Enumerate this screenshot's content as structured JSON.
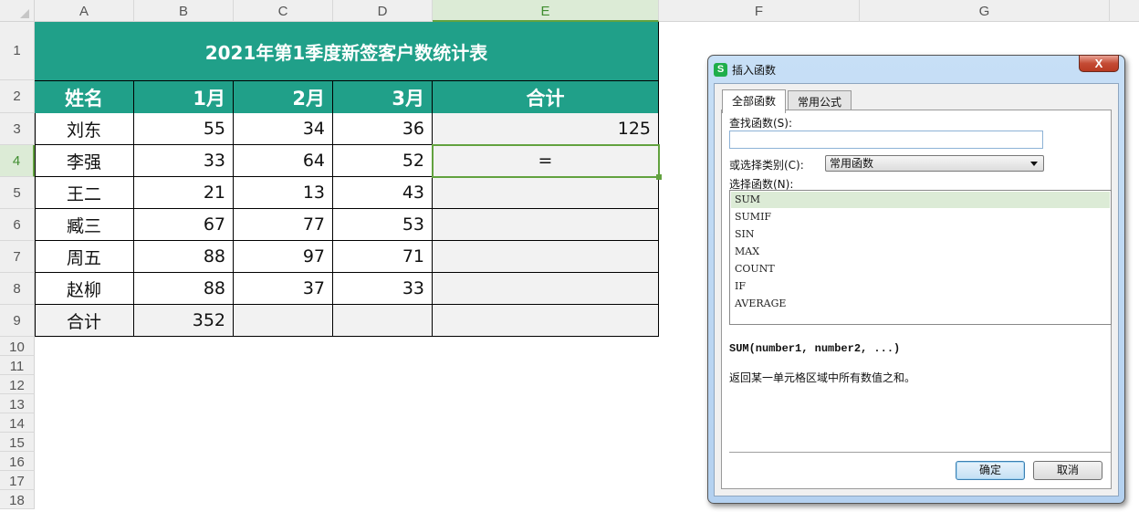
{
  "sheet": {
    "columns": [
      "A",
      "B",
      "C",
      "D",
      "E",
      "F",
      "G"
    ],
    "active_column": "E",
    "rows": [
      "1",
      "2",
      "3",
      "4",
      "5",
      "6",
      "7",
      "8",
      "9",
      "10",
      "11",
      "12",
      "13",
      "14",
      "15",
      "16",
      "17",
      "18"
    ],
    "active_row": "4",
    "title": "2021年第1季度新签客户数统计表",
    "headers": [
      "姓名",
      "1月",
      "2月",
      "3月",
      "合计"
    ],
    "data": [
      {
        "name": "刘东",
        "m1": "55",
        "m2": "34",
        "m3": "36",
        "total": "125"
      },
      {
        "name": "李强",
        "m1": "33",
        "m2": "64",
        "m3": "52",
        "total": "="
      },
      {
        "name": "王二",
        "m1": "21",
        "m2": "13",
        "m3": "43",
        "total": ""
      },
      {
        "name": "臧三",
        "m1": "67",
        "m2": "77",
        "m3": "53",
        "total": ""
      },
      {
        "name": "周五",
        "m1": "88",
        "m2": "97",
        "m3": "71",
        "total": ""
      },
      {
        "name": "赵柳",
        "m1": "88",
        "m2": "37",
        "m3": "33",
        "total": ""
      }
    ],
    "summary": {
      "label": "合计",
      "m1": "352",
      "m2": "",
      "m3": "",
      "total": ""
    },
    "colors": {
      "header_fill": "#20a089",
      "selection": "#62a23f"
    }
  },
  "dialog": {
    "app_icon": "S",
    "title": "插入函数",
    "close_icon": "close-icon",
    "close_glyph": "X",
    "tabs": [
      "全部函数",
      "常用公式"
    ],
    "active_tab": "全部函数",
    "search_label": "查找函数(S):",
    "search_value": "",
    "category_label": "或选择类别(C):",
    "category_value": "常用函数",
    "list_label": "选择函数(N):",
    "functions": [
      "SUM",
      "SUMIF",
      "SIN",
      "MAX",
      "COUNT",
      "IF",
      "AVERAGE"
    ],
    "selected_function": "SUM",
    "signature": "SUM(number1, number2, ...)",
    "description": "返回某一单元格区域中所有数值之和。",
    "ok_label": "确定",
    "cancel_label": "取消"
  }
}
